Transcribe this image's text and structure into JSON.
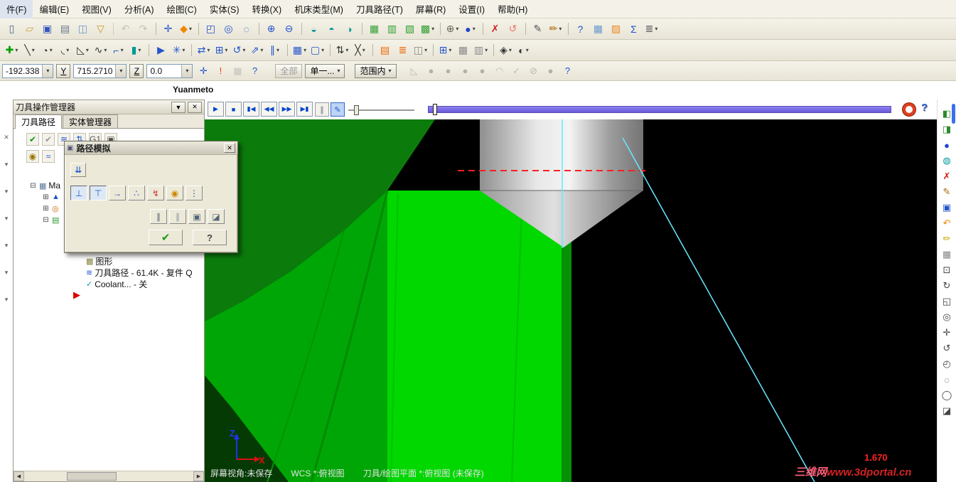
{
  "menu": {
    "items": [
      {
        "name": "menu-file",
        "label": "件(F)"
      },
      {
        "name": "menu-edit",
        "label": "编辑(E)"
      },
      {
        "name": "menu-view",
        "label": "视图(V)"
      },
      {
        "name": "menu-analyze",
        "label": "分析(A)"
      },
      {
        "name": "menu-create",
        "label": "绘图(C)"
      },
      {
        "name": "menu-solids",
        "label": "实体(S)"
      },
      {
        "name": "menu-xform",
        "label": "转换(X)"
      },
      {
        "name": "menu-machine-type",
        "label": "机床类型(M)"
      },
      {
        "name": "menu-toolpaths",
        "label": "刀具路径(T)"
      },
      {
        "name": "menu-screen",
        "label": "屏幕(R)"
      },
      {
        "name": "menu-settings",
        "label": "设置(I)"
      },
      {
        "name": "menu-help",
        "label": "帮助(H)"
      }
    ]
  },
  "toolbar_main": [
    {
      "name": "new-file-icon",
      "glyph": "▯",
      "color": "#446688"
    },
    {
      "name": "open-file-icon",
      "glyph": "▱",
      "color": "#c8a23c"
    },
    {
      "name": "save-icon",
      "glyph": "▣",
      "color": "#3355bb"
    },
    {
      "name": "print-icon",
      "glyph": "▤",
      "color": "#667788"
    },
    {
      "name": "print-preview-icon",
      "glyph": "◫",
      "color": "#6699cc"
    },
    {
      "name": "import-icon",
      "glyph": "▽",
      "color": "#cc9922"
    },
    {
      "name": "undo-icon",
      "glyph": "↶",
      "color": "#a0a095",
      "disabled": true,
      "sep": true
    },
    {
      "name": "redo-icon",
      "glyph": "↷",
      "color": "#a0a095",
      "disabled": true
    },
    {
      "name": "gnomon-icon",
      "glyph": "✛",
      "color": "#2255cc",
      "sep": true
    },
    {
      "name": "autocursor-icon",
      "glyph": "◆",
      "color": "#ee8800",
      "dd": true
    },
    {
      "name": "zoom-window-icon",
      "glyph": "◰",
      "color": "#2255cc",
      "sep": true
    },
    {
      "name": "zoom-target-icon",
      "glyph": "◎",
      "color": "#2255cc"
    },
    {
      "name": "zoom-previous-icon",
      "glyph": "◌",
      "color": "#2255cc"
    },
    {
      "name": "zoom-in-icon",
      "glyph": "⊕",
      "color": "#2255cc",
      "sep": true
    },
    {
      "name": "zoom-out-icon",
      "glyph": "⊖",
      "color": "#2255cc"
    },
    {
      "name": "repaint-icon",
      "glyph": "◒",
      "color": "#119999",
      "sep": true
    },
    {
      "name": "regen-display-icon",
      "glyph": "◓",
      "color": "#119999"
    },
    {
      "name": "display-toggle-icon",
      "glyph": "◑",
      "color": "#119999"
    },
    {
      "name": "gview-top-icon",
      "glyph": "▦",
      "color": "#2f9e2f",
      "sep": true
    },
    {
      "name": "gview-front-icon",
      "glyph": "▥",
      "color": "#2f9e2f"
    },
    {
      "name": "gview-side-icon",
      "glyph": "▧",
      "color": "#2f9e2f"
    },
    {
      "name": "gview-isometric-icon",
      "glyph": "▩",
      "color": "#2f9e2f",
      "dd": true
    },
    {
      "name": "planes-icon",
      "glyph": "⊕",
      "color": "#666655",
      "dd": true,
      "sep": true
    },
    {
      "name": "shading-icon",
      "glyph": "●",
      "color": "#2244cc",
      "dd": true
    },
    {
      "name": "delete-entities-icon",
      "glyph": "✗",
      "color": "#cc2222",
      "sep": true
    },
    {
      "name": "undelete-icon",
      "glyph": "↺",
      "color": "#ee7766"
    },
    {
      "name": "analyze-entity-icon",
      "glyph": "✎",
      "color": "#555555",
      "sep": true
    },
    {
      "name": "attributes-icon",
      "glyph": "✏",
      "color": "#aa6600",
      "dd": true
    },
    {
      "name": "quick-mask-help-icon",
      "glyph": "?",
      "color": "#2255cc",
      "sep": true
    },
    {
      "name": "grid-icon",
      "glyph": "▦",
      "color": "#6699cc"
    },
    {
      "name": "ortho-grid-icon",
      "glyph": "▨",
      "color": "#ee8822"
    },
    {
      "name": "solids-sigma-icon",
      "glyph": "Σ",
      "color": "#2255cc"
    },
    {
      "name": "mru-list-icon",
      "glyph": "≣",
      "color": "#555555",
      "dd": true
    }
  ],
  "toolbar_create": [
    {
      "name": "create-point-icon",
      "glyph": "✚",
      "color": "#00a000",
      "dd": true
    },
    {
      "name": "create-line-icon",
      "glyph": "╲",
      "color": "#333333",
      "dd": true
    },
    {
      "name": "create-arc-icon",
      "glyph": "◔",
      "color": "#333333",
      "dd": true
    },
    {
      "name": "create-fillet-icon",
      "glyph": "◟",
      "color": "#333333",
      "dd": true
    },
    {
      "name": "create-chamfer-icon",
      "glyph": "◺",
      "color": "#333333",
      "dd": true
    },
    {
      "name": "create-spline-icon",
      "glyph": "∿",
      "color": "#333333",
      "dd": true
    },
    {
      "name": "create-drafting-icon",
      "glyph": "⌐",
      "color": "#2266bb",
      "dd": true
    },
    {
      "name": "create-surface-icon",
      "glyph": "▮",
      "color": "#009999",
      "dd": true
    },
    {
      "name": "analyze-position-icon",
      "glyph": "▶",
      "color": "#2255cc",
      "sep": true
    },
    {
      "name": "analyze-dynamic-icon",
      "glyph": "✳",
      "color": "#2255cc",
      "dd": true
    },
    {
      "name": "xform-translate-icon",
      "glyph": "⇄",
      "color": "#2255cc",
      "dd": true,
      "sep": true
    },
    {
      "name": "xform-mirror-icon",
      "glyph": "⊞",
      "color": "#2255cc",
      "dd": true
    },
    {
      "name": "xform-rotate-icon",
      "glyph": "↺",
      "color": "#2255cc",
      "dd": true
    },
    {
      "name": "xform-scale-icon",
      "glyph": "⇗",
      "color": "#2255cc",
      "dd": true
    },
    {
      "name": "xform-offset-icon",
      "glyph": "∥",
      "color": "#2255cc",
      "dd": true
    },
    {
      "name": "xform-project-icon",
      "glyph": "▦",
      "color": "#2255cc",
      "dd": true,
      "sep": true
    },
    {
      "name": "xform-array-icon",
      "glyph": "▢",
      "color": "#2255cc",
      "dd": true
    },
    {
      "name": "sort-icon",
      "glyph": "⇅",
      "color": "#333333",
      "dd": true,
      "sep": true
    },
    {
      "name": "trim-break-icon",
      "glyph": "╳",
      "color": "#333333",
      "dd": true
    },
    {
      "name": "machine-def-icon",
      "glyph": "▤",
      "color": "#ee6600",
      "sep": true
    },
    {
      "name": "control-def-icon",
      "glyph": "≣",
      "color": "#ee6600"
    },
    {
      "name": "material-icon",
      "glyph": "◫",
      "color": "#888888",
      "dd": true
    },
    {
      "name": "toolpath-editor-icon",
      "glyph": "⊞",
      "color": "#2255cc",
      "dd": true,
      "sep": true
    },
    {
      "name": "stock-icon",
      "glyph": "▦",
      "color": "#888888"
    },
    {
      "name": "operations-icon",
      "glyph": "▥",
      "color": "#888888",
      "dd": true
    },
    {
      "name": "screen-config-icon",
      "glyph": "◈",
      "color": "#333333",
      "dd": true,
      "sep": true
    },
    {
      "name": "display-combine-icon",
      "glyph": "◐",
      "color": "#333333",
      "dd": true
    }
  ],
  "coordbar": {
    "x_value": "-192.338",
    "y_label": "Y",
    "y_value": "715.2710",
    "z_label": "Z",
    "z_value": "0.0",
    "select_all": "全部",
    "select_single": "单一...",
    "select_range": "范围内",
    "left_icons": [
      {
        "name": "fastpoint-icon",
        "glyph": "✛",
        "color": "#2255cc"
      },
      {
        "name": "autocursor-alert-icon",
        "glyph": "!",
        "color": "#ee4400"
      },
      {
        "name": "cursor-config-icon",
        "glyph": "▦",
        "color": "#999999",
        "disabled": true
      },
      {
        "name": "coord-help-icon",
        "glyph": "?",
        "color": "#2255cc"
      }
    ],
    "right_icons": [
      {
        "name": "select-window-icon",
        "glyph": "◺",
        "color": "#888888",
        "disabled": true
      },
      {
        "name": "select-solid-face-icon",
        "glyph": "●",
        "color": "#777777",
        "disabled": true
      },
      {
        "name": "select-solid-body-icon",
        "glyph": "●",
        "color": "#777777",
        "disabled": true
      },
      {
        "name": "select-solid-edge-icon",
        "glyph": "●",
        "color": "#777777",
        "disabled": true
      },
      {
        "name": "select-solid-vertex-icon",
        "glyph": "●",
        "color": "#777777",
        "disabled": true
      },
      {
        "name": "select-chain-icon",
        "glyph": "◠",
        "color": "#888888",
        "disabled": true
      },
      {
        "name": "select-ok-icon",
        "glyph": "✓",
        "color": "#888888",
        "disabled": true
      },
      {
        "name": "unselect-icon",
        "glyph": "⊘",
        "color": "#888888",
        "disabled": true
      },
      {
        "name": "select-all-solid-icon",
        "glyph": "●",
        "color": "#777777",
        "disabled": true
      },
      {
        "name": "selection-help-icon",
        "glyph": "?",
        "color": "#2255cc"
      }
    ]
  },
  "hint_label": "Yuanmeto",
  "left_dock": [
    {
      "name": "dock-close-icon",
      "glyph": "✕",
      "color": "#666666"
    },
    {
      "name": "dock-flyout-2-icon",
      "glyph": "▾",
      "color": "#666666"
    },
    {
      "name": "dock-flyout-3-icon",
      "glyph": "▾",
      "color": "#666666"
    },
    {
      "name": "dock-flyout-4-icon",
      "glyph": "▾",
      "color": "#666666"
    },
    {
      "name": "dock-flyout-5-icon",
      "glyph": "▾",
      "color": "#666666"
    },
    {
      "name": "dock-flyout-6-icon",
      "glyph": "▾",
      "color": "#666666"
    },
    {
      "name": "dock-flyout-7-icon",
      "glyph": "▾",
      "color": "#666666"
    }
  ],
  "ops_panel": {
    "title": "刀具操作管理器",
    "dropdown_glyph": "▼",
    "close_glyph": "✕",
    "tabs": [
      {
        "name": "tab-toolpaths",
        "label": "刀具路径",
        "active": true
      },
      {
        "name": "tab-solids-manager",
        "label": "实体管理器"
      }
    ],
    "toolbar_row1": [
      {
        "name": "ops-select-all-icon",
        "glyph": "✔",
        "color": "#119911"
      },
      {
        "name": "ops-regen-all-icon",
        "glyph": "✔",
        "color": "#999999"
      },
      {
        "name": "ops-backplot-icon",
        "glyph": "≋",
        "color": "#2255cc"
      },
      {
        "name": "ops-verify-icon",
        "glyph": "⇅",
        "color": "#2255cc"
      },
      {
        "name": "ops-post-icon",
        "glyph": "G1",
        "color": "#555555"
      },
      {
        "name": "ops-highfeed-icon",
        "glyph": "▣",
        "color": "#555555"
      }
    ],
    "toolbar_row2": [
      {
        "name": "ops-lock-icon",
        "glyph": "◉",
        "color": "#997700"
      },
      {
        "name": "ops-toolpath-display-icon",
        "glyph": "≈",
        "color": "#2255cc"
      }
    ],
    "tree": [
      {
        "name": "tree-machine-group",
        "depth": 0,
        "exp": "⊟",
        "icon": "▦",
        "color": "#557799",
        "label": "Ma"
      },
      {
        "name": "tree-properties",
        "depth": 1,
        "exp": "⊞",
        "icon": "▲",
        "color": "#2255cc",
        "label": ""
      },
      {
        "name": "tree-tool-settings",
        "depth": 1,
        "exp": "⊞",
        "icon": "◎",
        "color": "#cc6600",
        "label": ""
      },
      {
        "name": "tree-operation",
        "depth": 1,
        "exp": "⊟",
        "icon": "▤",
        "color": "#339933",
        "label": ""
      },
      {
        "name": "tree-geometry",
        "depth": 2,
        "icon": "▩",
        "color": "#888844",
        "label": "图形"
      },
      {
        "name": "tree-toolpath-file",
        "depth": 2,
        "icon": "≋",
        "color": "#2255cc",
        "label": "刀具路径 - 61.4K - 复件 Q"
      },
      {
        "name": "tree-coolant",
        "depth": 2,
        "icon": "✓",
        "color": "#119999",
        "label": "Coolant... - 关"
      },
      {
        "name": "tree-insert-arrow",
        "icon": "▶",
        "color": "#dd0000",
        "label": "",
        "arrow": true
      }
    ]
  },
  "backplot_dialog": {
    "title": "路径模拟",
    "title_icon": "▣",
    "close_glyph": "✕",
    "expand_icon": "⇊",
    "display_buttons": [
      {
        "name": "show-tool-button",
        "glyph": "⊥",
        "color": "#2255cc",
        "active": true
      },
      {
        "name": "show-holder-button",
        "glyph": "⊤",
        "color": "#2255cc",
        "active": true
      },
      {
        "name": "show-rapid-button",
        "glyph": "→",
        "color": "#2255cc"
      },
      {
        "name": "show-endpoints-button",
        "glyph": "∴",
        "color": "#2255cc"
      },
      {
        "name": "show-vectors-button",
        "glyph": "↯",
        "color": "#cc3333"
      },
      {
        "name": "follow-tool-button",
        "glyph": "◉",
        "color": "#cc8800"
      },
      {
        "name": "run-options-button",
        "glyph": "⋮",
        "color": "#2255cc"
      }
    ],
    "option_buttons": [
      {
        "name": "fade-prev-button",
        "glyph": "∥",
        "color": "#556677"
      },
      {
        "name": "trace-mode-button",
        "glyph": "∥",
        "color": "#8899aa"
      },
      {
        "name": "snapshot-button",
        "glyph": "▣",
        "color": "#556677"
      },
      {
        "name": "save-as-geometry-button",
        "glyph": "◪",
        "color": "#556677"
      }
    ],
    "ok_glyph": "✔",
    "help_glyph": "?"
  },
  "playback": {
    "buttons": [
      {
        "name": "backplot-play-button",
        "glyph": "▶"
      },
      {
        "name": "backplot-stop-button",
        "glyph": "■"
      },
      {
        "name": "backplot-rewind-button",
        "glyph": "▮◀"
      },
      {
        "name": "backplot-step-back-button",
        "glyph": "◀◀"
      },
      {
        "name": "backplot-step-forward-button",
        "glyph": "▶▶"
      },
      {
        "name": "backplot-go-to-end-button",
        "glyph": "▶▮"
      }
    ],
    "toggles": [
      {
        "name": "display-path-toggle",
        "glyph": "∥",
        "color": "#667788"
      },
      {
        "name": "quality-toggle",
        "glyph": "✎",
        "color": "#2255cc",
        "active": true
      }
    ]
  },
  "viewport": {
    "status_view": "屏幕视角:未保存",
    "status_wcs": "WCS *:俯视图",
    "status_plane": "刀具/绘图平面 *:俯视图 (未保存)",
    "measure_value": "1.670",
    "watermark_site": "三维网",
    "watermark_url": "www.3dportal.cn",
    "axis_z": "Z",
    "axis_x": "X"
  },
  "right_toolbar": [
    {
      "name": "gview-cube-icon",
      "glyph": "◧",
      "color": "#2a8a2a"
    },
    {
      "name": "gview-cube2-icon",
      "glyph": "◨",
      "color": "#2a8a2a"
    },
    {
      "name": "shading-sphere-icon",
      "glyph": "●",
      "color": "#2244cc"
    },
    {
      "name": "wireframe-globe-icon",
      "glyph": "◍",
      "color": "#009999"
    },
    {
      "name": "delete-icon",
      "glyph": "✗",
      "color": "#cc2222"
    },
    {
      "name": "analyze-pencil-icon",
      "glyph": "✎",
      "color": "#aa6600"
    },
    {
      "name": "screen-shot-icon",
      "glyph": "▣",
      "color": "#2255cc"
    },
    {
      "name": "undo-view-icon",
      "glyph": "↶",
      "color": "#ee8800"
    },
    {
      "name": "clear-colors-icon",
      "glyph": "✏",
      "color": "#ccaa00"
    },
    {
      "name": "levels-icon",
      "glyph": "▦",
      "color": "#888888"
    },
    {
      "name": "fit-screen-icon",
      "glyph": "⊡",
      "color": "#444444"
    },
    {
      "name": "repaint-view-icon",
      "glyph": "↻",
      "color": "#444444"
    },
    {
      "name": "zoom-window2-icon",
      "glyph": "◱",
      "color": "#444444"
    },
    {
      "name": "zoom-target2-icon",
      "glyph": "◎",
      "color": "#444444"
    },
    {
      "name": "pan-icon",
      "glyph": "✛",
      "color": "#444444"
    },
    {
      "name": "dynamic-rotate-icon",
      "glyph": "↺",
      "color": "#444444"
    },
    {
      "name": "previous-view-icon",
      "glyph": "◴",
      "color": "#444444"
    },
    {
      "name": "hide-entities-icon",
      "glyph": "◌",
      "color": "#444444"
    },
    {
      "name": "isolate-icon",
      "glyph": "◯",
      "color": "#444444"
    },
    {
      "name": "section-view-icon",
      "glyph": "◪",
      "color": "#444444"
    }
  ],
  "colors": {
    "part_bright": "#00d800",
    "part_mid": "#00a605",
    "part_dark": "#0b7c0b",
    "part_sliver": "#069006",
    "part_corner": "#053a05",
    "progress_purple": "#7a6be0",
    "dash_red": "#ff1f1f",
    "highlight_cyan": "#66eaff"
  }
}
